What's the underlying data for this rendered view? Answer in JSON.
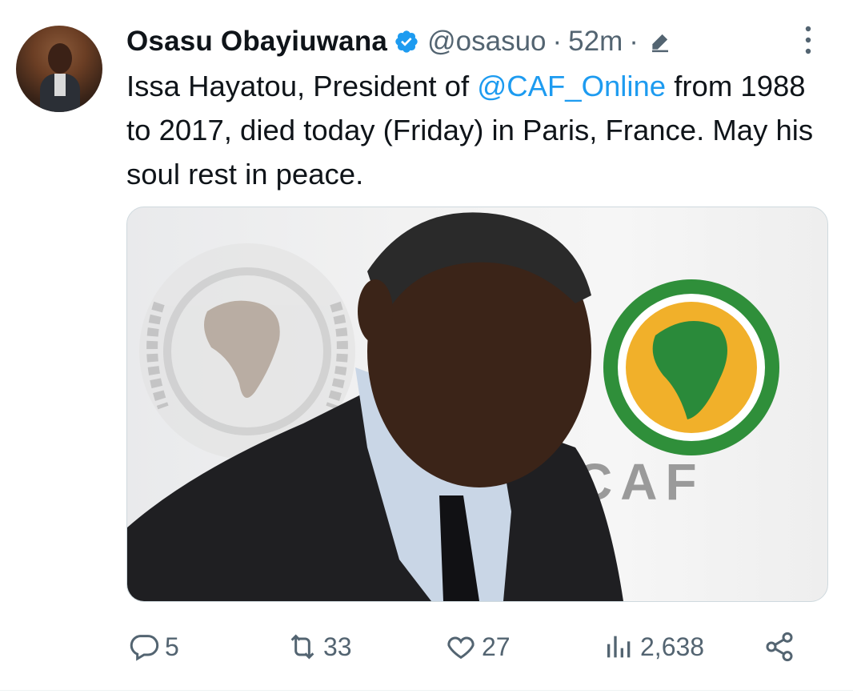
{
  "tweet": {
    "author": {
      "name": "Osasu Obayiuwana",
      "handle": "@osasuo",
      "verified": true
    },
    "separator": "·",
    "time": "52m",
    "text_before": "Issa Hayatou, President of ",
    "mention": "@CAF_Online",
    "text_after": " from 1988 to 2017, died today (Friday) in Paris, France. May his soul rest in peace.",
    "media": {
      "logo_text": "CAF"
    },
    "actions": {
      "replies": "5",
      "retweets": "33",
      "likes": "27",
      "views": "2,638"
    }
  },
  "colors": {
    "text": "#0f1419",
    "secondary": "#536471",
    "link": "#1d9bf0",
    "verified": "#1d9bf0"
  },
  "icons": [
    "verified-badge-icon",
    "edit-icon",
    "more-icon",
    "reply-icon",
    "retweet-icon",
    "like-icon",
    "views-icon",
    "share-icon"
  ]
}
